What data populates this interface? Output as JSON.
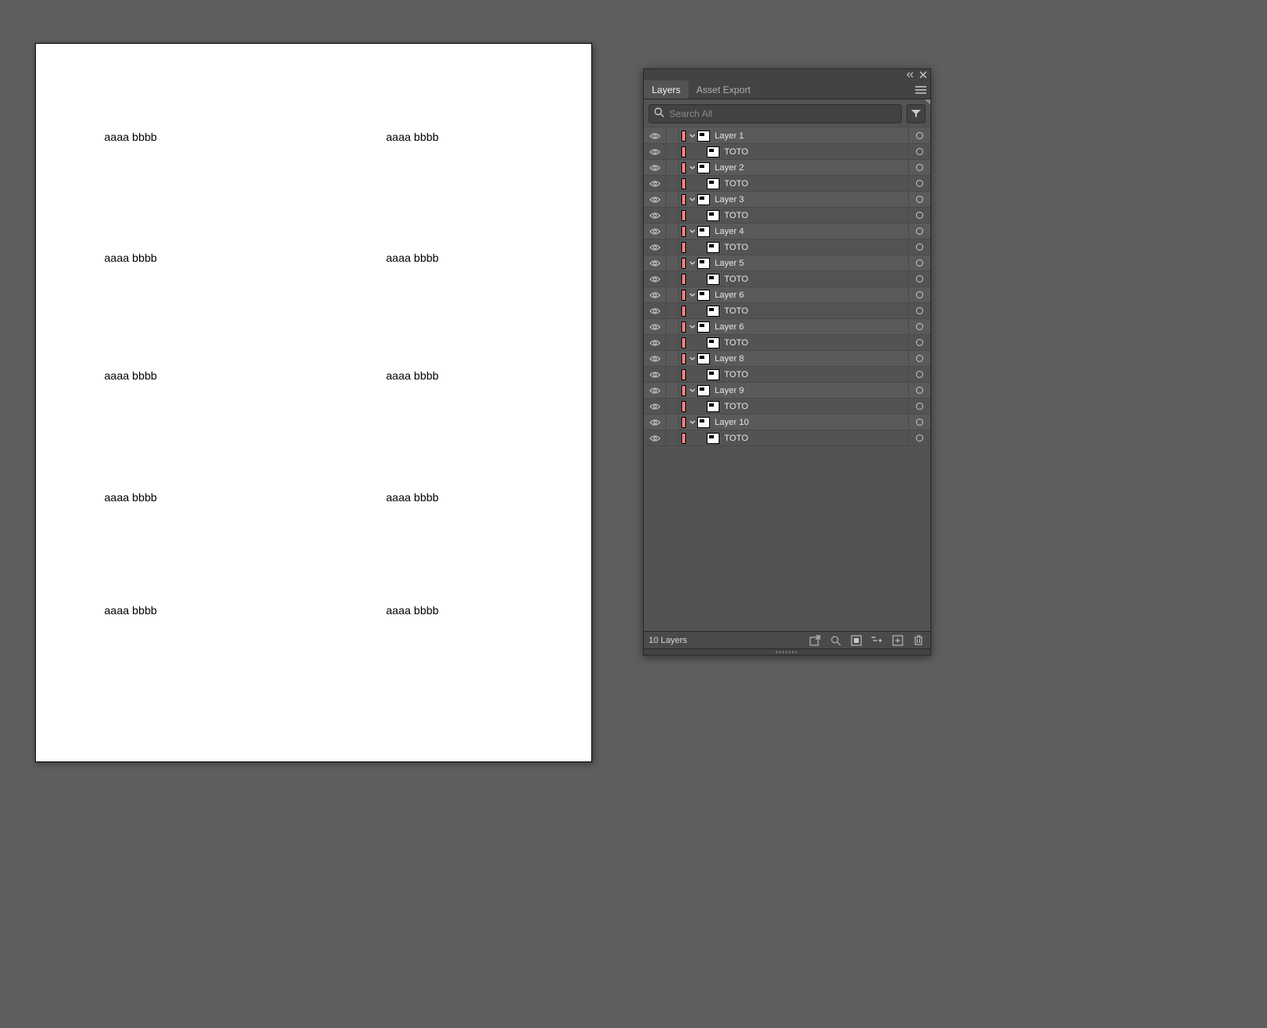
{
  "canvas": {
    "text": "aaaa bbbb",
    "columns_x": [
      130,
      484
    ],
    "rows_y": [
      163,
      315,
      463,
      616,
      758
    ]
  },
  "panel": {
    "tabs": {
      "layers": "Layers",
      "asset_export": "Asset Export"
    },
    "search_placeholder": "Search All",
    "footer_status": "10 Layers"
  },
  "layers": [
    {
      "name": "Layer 1",
      "children": [
        {
          "name": "TOTO"
        }
      ]
    },
    {
      "name": "Layer 2",
      "children": [
        {
          "name": "TOTO"
        }
      ]
    },
    {
      "name": "Layer 3",
      "children": [
        {
          "name": "TOTO"
        }
      ]
    },
    {
      "name": "Layer 4",
      "children": [
        {
          "name": "TOTO"
        }
      ]
    },
    {
      "name": "Layer 5",
      "children": [
        {
          "name": "TOTO"
        }
      ]
    },
    {
      "name": "Layer 6",
      "children": [
        {
          "name": "TOTO"
        }
      ]
    },
    {
      "name": "Layer 6",
      "children": [
        {
          "name": "TOTO"
        }
      ]
    },
    {
      "name": "Layer 8",
      "children": [
        {
          "name": "TOTO"
        }
      ]
    },
    {
      "name": "Layer 9",
      "children": [
        {
          "name": "TOTO"
        }
      ]
    },
    {
      "name": "Layer 10",
      "children": [
        {
          "name": "TOTO"
        }
      ]
    }
  ]
}
